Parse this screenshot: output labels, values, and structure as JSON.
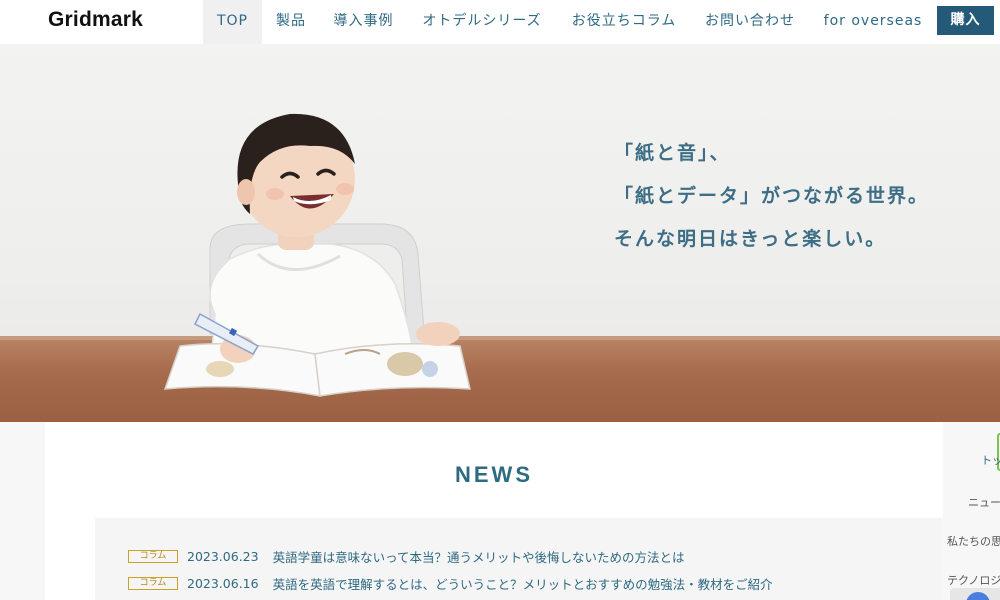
{
  "header": {
    "logo": "Gridmark",
    "nav": [
      {
        "label": "TOP",
        "active": true
      },
      {
        "label": "製品"
      },
      {
        "label": "導入事例"
      },
      {
        "label": "オトデルシリーズ"
      },
      {
        "label": "お役立ちコラム"
      },
      {
        "label": "お問い合わせ"
      },
      {
        "label": "for overseas"
      }
    ],
    "buy_label": "購入"
  },
  "hero": {
    "lines": [
      "「紙と音」、",
      "「紙とデータ」がつながる世界。",
      "そんな明日はきっと楽しい。"
    ]
  },
  "news": {
    "title": "NEWS",
    "items": [
      {
        "tag": "コラム",
        "date": "2023.06.23",
        "title": "英語学童は意味ないって本当？通うメリットや後悔しないための方法とは"
      },
      {
        "tag": "コラム",
        "date": "2023.06.16",
        "title": "英語を英語で理解するとは、どういうこと？メリットとおすすめの勉強法・教材をご紹介"
      }
    ]
  },
  "side_nav": [
    "トップ",
    "ニュース",
    "私たちの思い",
    "テクノロジー"
  ],
  "colors": {
    "accent": "#2f6a83",
    "buy_button": "#245a78",
    "tag_border": "#c9a227",
    "side_marker": "#7cc352"
  }
}
